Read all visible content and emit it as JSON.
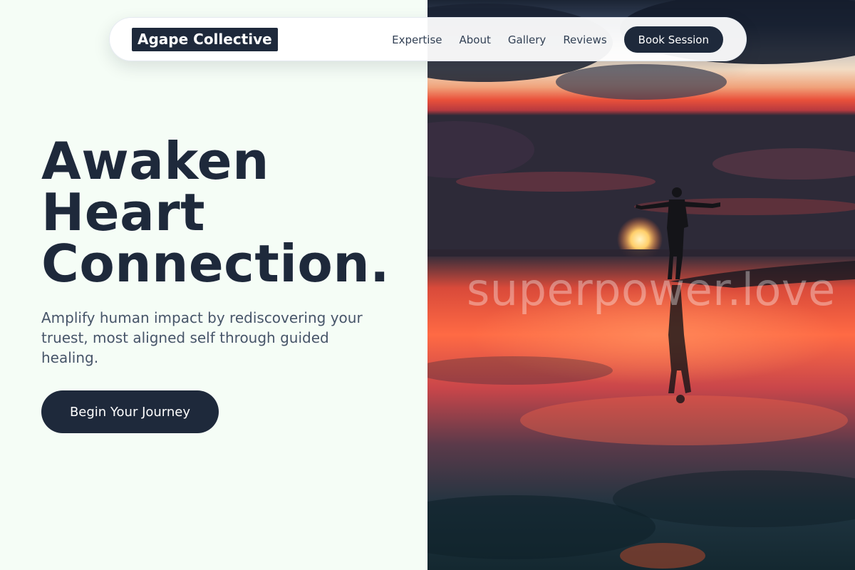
{
  "nav": {
    "brand": "Agape Collective",
    "links": [
      "Expertise",
      "About",
      "Gallery",
      "Reviews"
    ],
    "cta_label": "Book Session"
  },
  "hero": {
    "headline": [
      "Awaken",
      "Heart",
      "Connection."
    ],
    "subtitle": "Amplify human impact by rediscovering your truest, most aligned self through guided healing.",
    "cta_label": "Begin Your Journey"
  },
  "image": {
    "watermark": "superpower.love"
  },
  "colors": {
    "page_background": "#f5fdf6",
    "primary_dark": "#1e293b",
    "body_text": "#475569",
    "sunset_orange": "#ff5a2a",
    "sky_dark": "#1b2434"
  }
}
